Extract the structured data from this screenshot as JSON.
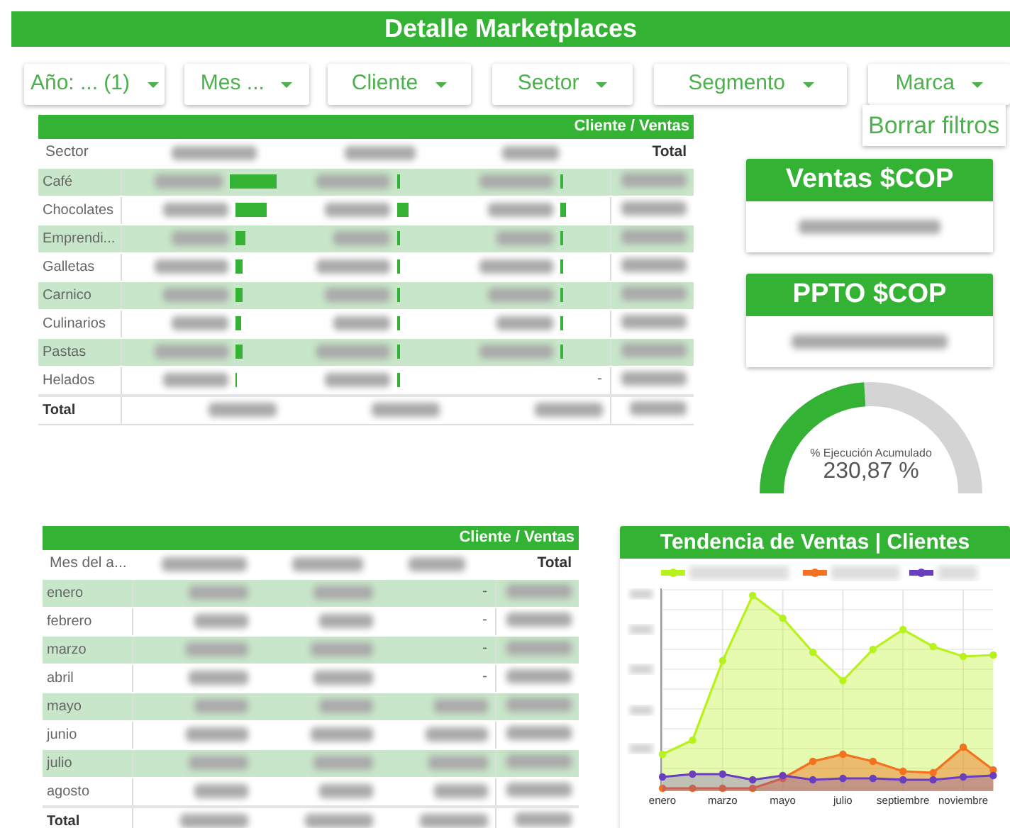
{
  "header": {
    "title": "Detalle Marketplaces"
  },
  "filters": [
    {
      "label": "Año: ... (1)"
    },
    {
      "label": "Mes ..."
    },
    {
      "label": "Cliente"
    },
    {
      "label": "Sector"
    },
    {
      "label": "Segmento"
    },
    {
      "label": "Marca"
    }
  ],
  "clear_button": {
    "label": "Borrar filtros"
  },
  "sector_table": {
    "caption": "Cliente / Ventas",
    "first_column": "Sector",
    "total_column": "Total",
    "total_label": "Total",
    "rows": [
      {
        "label": "Café",
        "cells": [
          {
            "kind": "hidden"
          },
          {
            "kind": "hidden"
          },
          {
            "kind": "hidden"
          }
        ]
      },
      {
        "label": "Chocolates",
        "cells": [
          {
            "kind": "hidden"
          },
          {
            "kind": "hidden"
          },
          {
            "kind": "hidden"
          }
        ]
      },
      {
        "label": "Emprendi...",
        "cells": [
          {
            "kind": "hidden"
          },
          {
            "kind": "hidden"
          },
          {
            "kind": "hidden"
          }
        ]
      },
      {
        "label": "Galletas",
        "cells": [
          {
            "kind": "hidden"
          },
          {
            "kind": "hidden"
          },
          {
            "kind": "hidden"
          }
        ]
      },
      {
        "label": "Carnico",
        "cells": [
          {
            "kind": "hidden"
          },
          {
            "kind": "hidden"
          },
          {
            "kind": "hidden"
          }
        ]
      },
      {
        "label": "Culinarios",
        "cells": [
          {
            "kind": "hidden"
          },
          {
            "kind": "hidden"
          },
          {
            "kind": "hidden"
          }
        ]
      },
      {
        "label": "Pastas",
        "cells": [
          {
            "kind": "hidden"
          },
          {
            "kind": "hidden"
          },
          {
            "kind": "hidden"
          }
        ]
      },
      {
        "label": "Helados",
        "cells": [
          {
            "kind": "hidden"
          },
          {
            "kind": "hidden"
          },
          {
            "kind": "text",
            "text": "-"
          }
        ]
      }
    ]
  },
  "kpis": [
    {
      "title": "Ventas $COP"
    },
    {
      "title": "PPTO $COP"
    }
  ],
  "gauge": {
    "label": "% Ejecución Acumulado",
    "reading": "230,87 %"
  },
  "month_table": {
    "caption": "Cliente / Ventas",
    "first_column": "Mes del a...",
    "total_column": "Total",
    "total_label": "Total",
    "rows": [
      {
        "label": "enero",
        "cells": [
          {
            "kind": "hidden"
          },
          {
            "kind": "hidden"
          },
          {
            "kind": "text",
            "text": "-"
          }
        ]
      },
      {
        "label": "febrero",
        "cells": [
          {
            "kind": "hidden"
          },
          {
            "kind": "hidden"
          },
          {
            "kind": "text",
            "text": "-"
          }
        ]
      },
      {
        "label": "marzo",
        "cells": [
          {
            "kind": "hidden"
          },
          {
            "kind": "hidden"
          },
          {
            "kind": "text",
            "text": "-"
          }
        ]
      },
      {
        "label": "abril",
        "cells": [
          {
            "kind": "hidden"
          },
          {
            "kind": "hidden"
          },
          {
            "kind": "text",
            "text": "-"
          }
        ]
      },
      {
        "label": "mayo",
        "cells": [
          {
            "kind": "hidden"
          },
          {
            "kind": "hidden"
          },
          {
            "kind": "hidden"
          }
        ]
      },
      {
        "label": "junio",
        "cells": [
          {
            "kind": "hidden"
          },
          {
            "kind": "hidden"
          },
          {
            "kind": "hidden"
          }
        ]
      },
      {
        "label": "julio",
        "cells": [
          {
            "kind": "hidden"
          },
          {
            "kind": "hidden"
          },
          {
            "kind": "hidden"
          }
        ]
      },
      {
        "label": "agosto",
        "cells": [
          {
            "kind": "hidden"
          },
          {
            "kind": "hidden"
          },
          {
            "kind": "hidden"
          }
        ]
      }
    ]
  },
  "trend_chart": {
    "title": "Tendencia de Ventas | Clientes",
    "x_labels": [
      "enero",
      "marzo",
      "mayo",
      "julio",
      "septiembre",
      "noviembre"
    ],
    "series": [
      {
        "color": "#b8f21c"
      },
      {
        "color": "#f4711f"
      },
      {
        "color": "#6a3fbf"
      }
    ]
  }
}
